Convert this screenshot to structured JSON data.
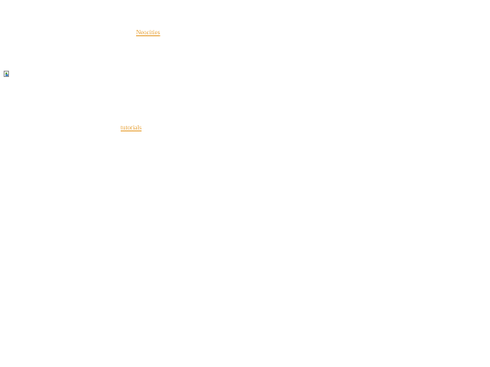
{
  "links": {
    "neocities": {
      "label": "Neocities"
    },
    "tutorials": {
      "label": "tutorials"
    }
  },
  "image": {
    "icon": "broken-image-icon"
  },
  "colors": {
    "link": "#e8a33a",
    "background": "#ffffff"
  }
}
